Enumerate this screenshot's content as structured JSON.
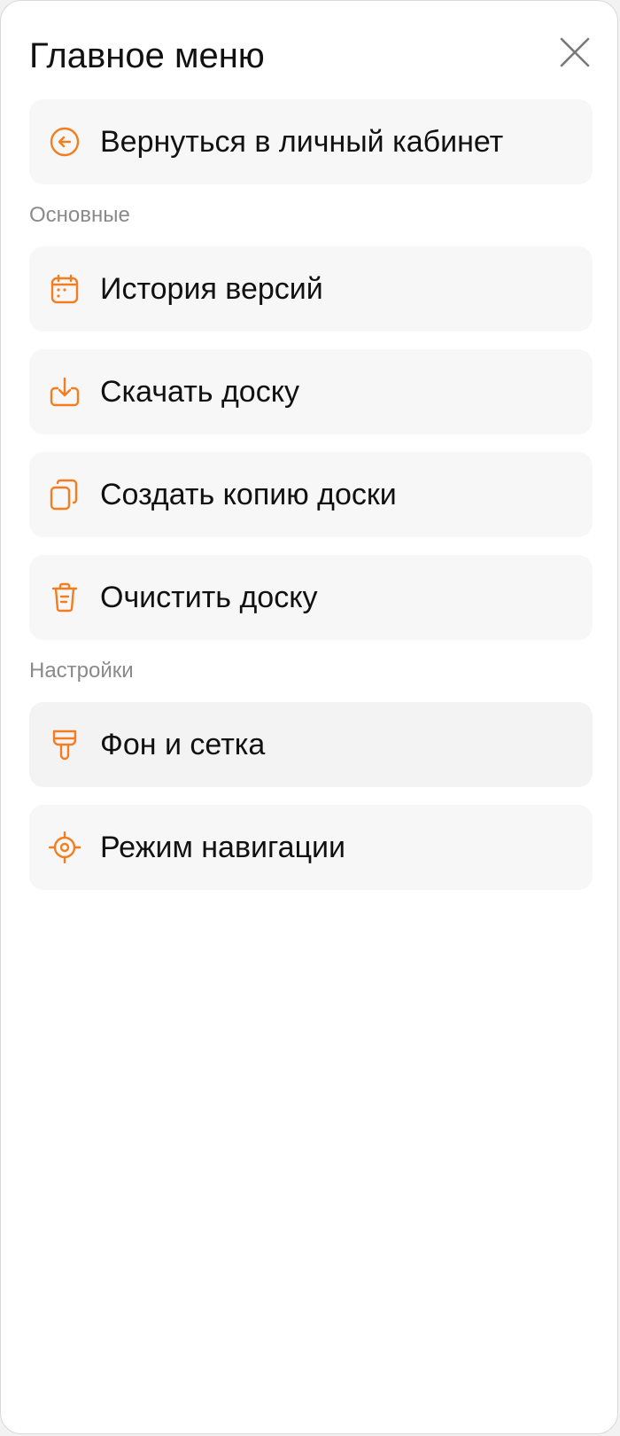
{
  "menu": {
    "title": "Главное меню",
    "close_icon": "close-icon",
    "accent_color": "#f47d20",
    "back_item": {
      "label": "Вернуться в личный кабинет",
      "icon": "arrow-left-circle-icon"
    },
    "sections": [
      {
        "label": "Основные",
        "items": [
          {
            "label": "История версий",
            "icon": "calendar-icon"
          },
          {
            "label": "Скачать доску",
            "icon": "download-icon"
          },
          {
            "label": "Создать копию доски",
            "icon": "copy-icon"
          },
          {
            "label": "Очистить доску",
            "icon": "trash-icon"
          }
        ]
      },
      {
        "label": "Настройки",
        "items": [
          {
            "label": "Фон и сетка",
            "icon": "brush-icon"
          },
          {
            "label": "Режим навигации",
            "icon": "target-icon"
          }
        ]
      }
    ]
  }
}
